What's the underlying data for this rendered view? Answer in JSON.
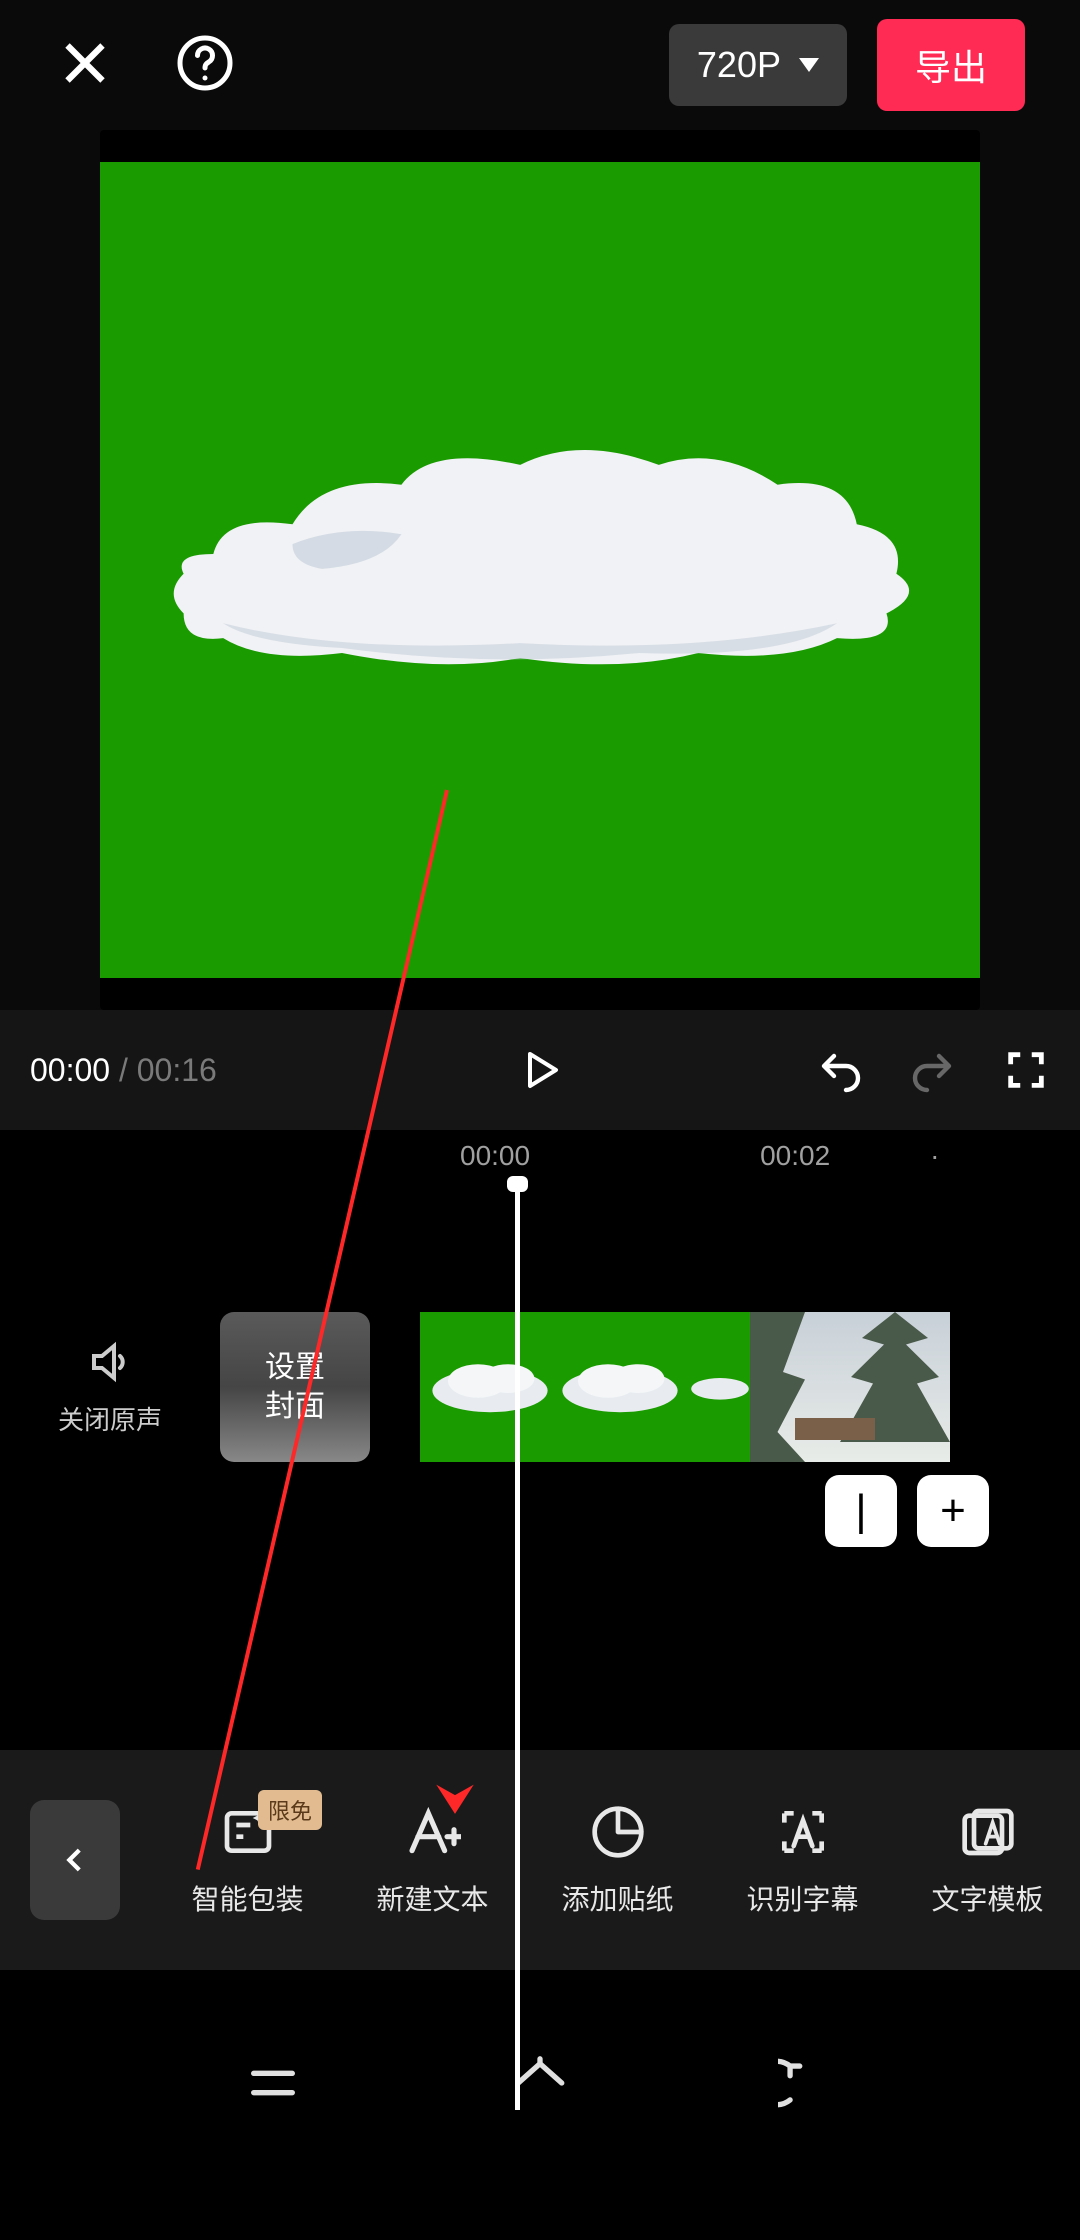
{
  "top": {
    "resolution": "720P",
    "export": "导出"
  },
  "playback": {
    "current": "00:00",
    "total": "00:16"
  },
  "ruler": {
    "t0": "00:00",
    "t1": "00:02",
    "dot": "·"
  },
  "track": {
    "mute_label": "关闭原声",
    "cover_line1": "设置",
    "cover_line2": "封面",
    "cut_btn": "|",
    "add_btn": "+"
  },
  "tools": {
    "badge": "限免",
    "items": [
      {
        "label": "智能包装"
      },
      {
        "label": "新建文本"
      },
      {
        "label": "添加贴纸"
      },
      {
        "label": "识别字幕"
      },
      {
        "label": "文字模板"
      }
    ]
  }
}
